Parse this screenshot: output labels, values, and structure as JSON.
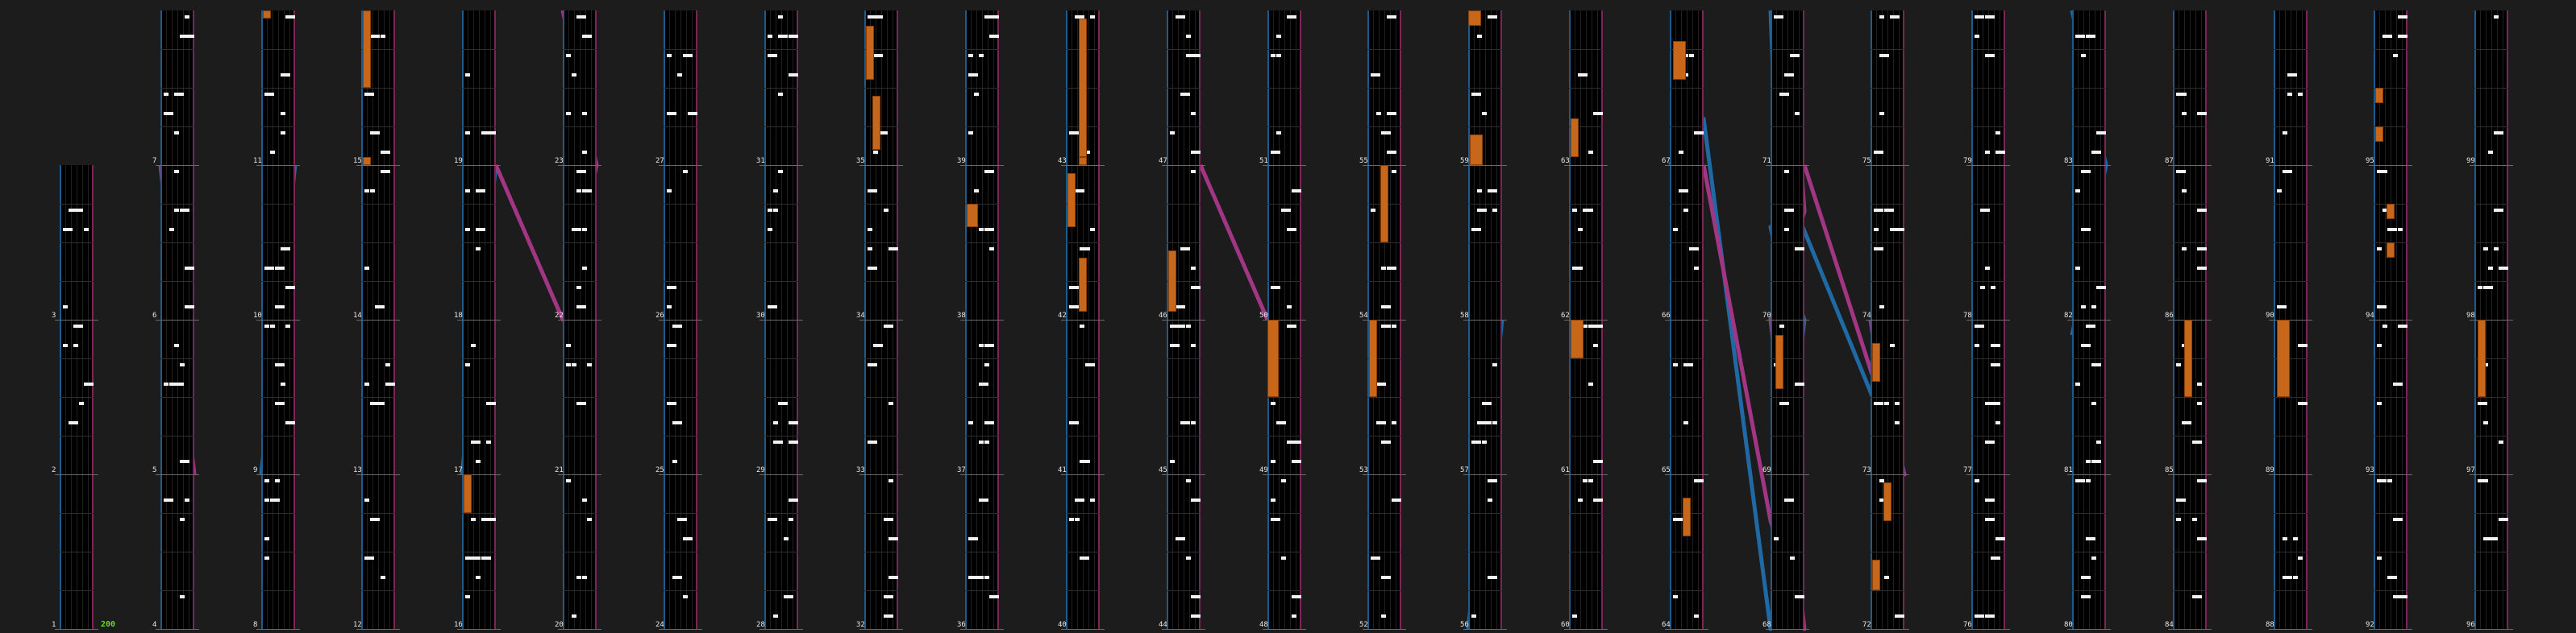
{
  "colors": {
    "background": "#1c1c1c",
    "lane_bg": "#000000",
    "left_lane": "#1e5a8a",
    "right_lane": "#7a2458",
    "note": "#f2f2f2",
    "hold": "#c8661a",
    "slide_blue": "#1f6aa5",
    "slide_pink": "#a33585",
    "bpm_text": "#66dd22"
  },
  "chart": {
    "bpm": "200",
    "measure_count": 99
  }
}
